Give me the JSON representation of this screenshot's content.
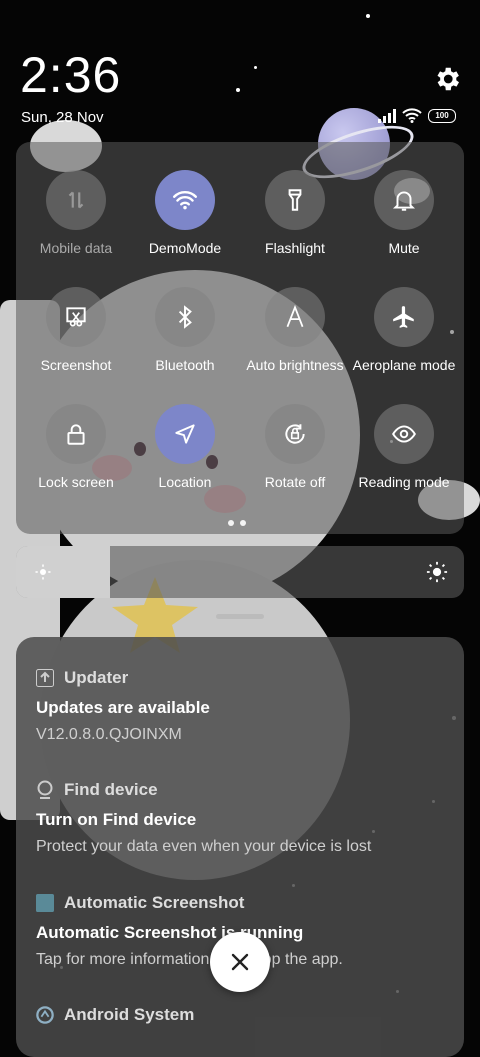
{
  "status": {
    "time": "2:36",
    "date": "Sun, 28 Nov",
    "battery": "100"
  },
  "quick_settings": {
    "tiles": [
      {
        "label": "Mobile data",
        "icon": "mobile-data-icon",
        "active": false,
        "dim": true
      },
      {
        "label": "DemoMode",
        "icon": "wifi-icon",
        "active": true,
        "dim": false
      },
      {
        "label": "Flashlight",
        "icon": "flashlight-icon",
        "active": false,
        "dim": false
      },
      {
        "label": "Mute",
        "icon": "bell-icon",
        "active": false,
        "dim": false
      },
      {
        "label": "Screenshot",
        "icon": "screenshot-icon",
        "active": false,
        "dim": false
      },
      {
        "label": "Bluetooth",
        "icon": "bluetooth-icon",
        "active": false,
        "dim": false
      },
      {
        "label": "Auto brightness",
        "icon": "auto-brightness-icon",
        "active": false,
        "dim": false
      },
      {
        "label": "Aeroplane mode",
        "icon": "airplane-icon",
        "active": false,
        "dim": false
      },
      {
        "label": "Lock screen",
        "icon": "lock-icon",
        "active": false,
        "dim": false
      },
      {
        "label": "Location",
        "icon": "location-icon",
        "active": true,
        "dim": false
      },
      {
        "label": "Rotate off",
        "icon": "rotate-lock-icon",
        "active": false,
        "dim": false
      },
      {
        "label": "Reading mode",
        "icon": "eye-icon",
        "active": false,
        "dim": false
      }
    ],
    "brightness_level": 0.21
  },
  "notifications": [
    {
      "app": "Updater",
      "icon": "update-icon",
      "title": "Updates are available",
      "body": "V12.0.8.0.QJOINXM"
    },
    {
      "app": "Find device",
      "icon": "find-device-icon",
      "title": "Turn on Find device",
      "body": "Protect your data even when your device is lost"
    },
    {
      "app": "Automatic Screenshot",
      "icon": "app-square-icon",
      "title": "Automatic Screenshot is running",
      "body": "Tap for more information or to stop the app."
    },
    {
      "app": "Android System",
      "icon": "android-system-icon",
      "title": "",
      "body": ""
    }
  ],
  "colors": {
    "active_tile": "#7d86c9",
    "panel": "#5a5a5a"
  }
}
